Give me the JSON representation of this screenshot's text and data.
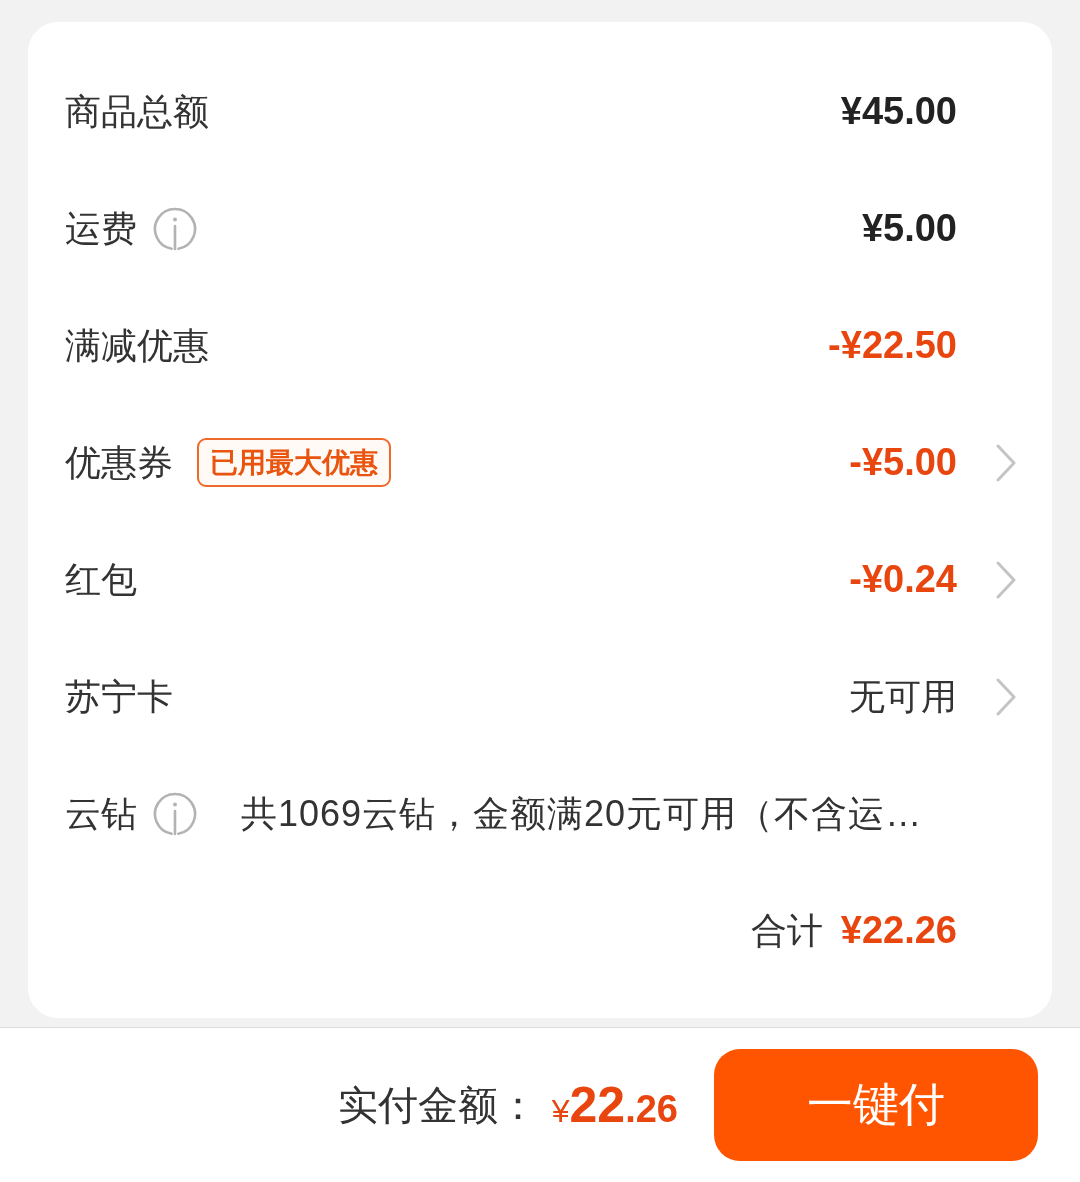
{
  "summary": {
    "rows": [
      {
        "kind": "amount",
        "label": "商品总额",
        "info": false,
        "value": "¥45.00",
        "chevron": false
      },
      {
        "kind": "amount",
        "label": "运费",
        "info": true,
        "value": "¥5.00",
        "chevron": false
      },
      {
        "kind": "discount",
        "label": "满减优惠",
        "info": false,
        "value": "-¥22.50",
        "chevron": false
      },
      {
        "kind": "discount",
        "label": "优惠券",
        "info": false,
        "badge": "已用最大优惠",
        "value": "-¥5.00",
        "chevron": true
      },
      {
        "kind": "discount",
        "label": "红包",
        "info": false,
        "value": "-¥0.24",
        "chevron": true
      },
      {
        "kind": "plain",
        "label": "苏宁卡",
        "info": false,
        "value": "无可用",
        "chevron": true
      },
      {
        "kind": "note",
        "label": "云钻",
        "info": true,
        "value": "共1069云钻，金额满20元可用（不含运…",
        "chevron": false
      }
    ],
    "total": {
      "label": "合计",
      "value": "¥22.26"
    }
  },
  "pay_bar": {
    "label": "实付金额：",
    "amount": {
      "currency": "¥",
      "integer": "22",
      "decimal": ".26"
    },
    "button": "一键付"
  }
}
